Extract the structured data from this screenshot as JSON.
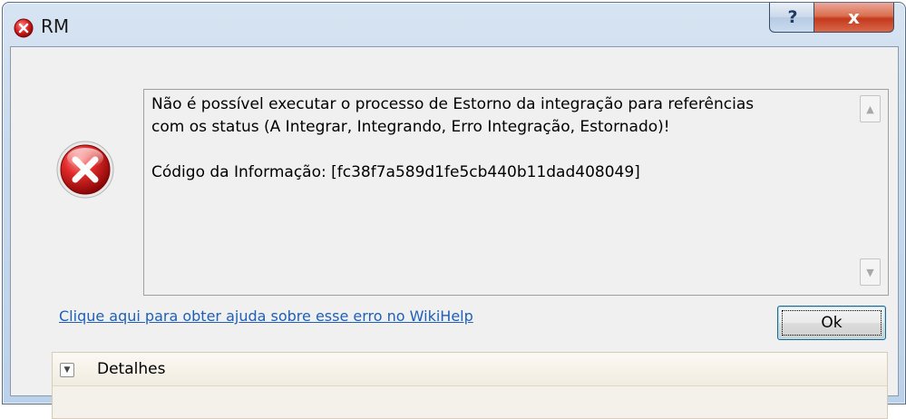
{
  "window": {
    "title": "RM",
    "help_label": "?",
    "close_label": "x"
  },
  "message": {
    "line1": "Não é possível executar o processo de Estorno da integração para referências",
    "line2": "com os status (A Integrar, Integrando, Erro Integração, Estornado)!",
    "code": "Código da Informação: [fc38f7a589d1fe5cb440b11dad408049]"
  },
  "help_link": "Clique aqui para obter ajuda sobre esse erro no WikiHelp",
  "ok_label": "Ok",
  "details": {
    "label": "Detalhes"
  },
  "icons": {
    "title": "error-icon",
    "main": "error-icon",
    "scroll_up": "scroll-up-arrow-icon",
    "scroll_down": "scroll-down-arrow-icon",
    "expand": "chevron-down-icon"
  },
  "colors": {
    "link": "#1f5fb8",
    "error_red": "#c41f1f",
    "close_button": "#c4391c"
  }
}
